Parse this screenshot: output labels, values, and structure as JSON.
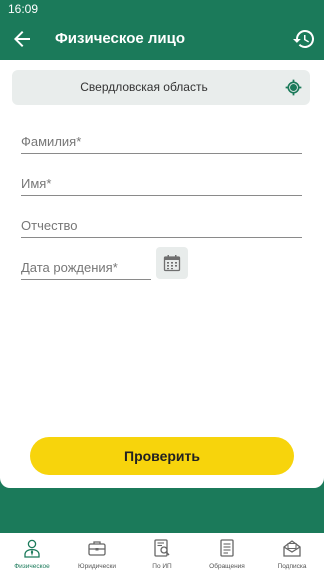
{
  "status_bar": {
    "time": "16:09"
  },
  "app_bar": {
    "title": "Физическое лицо",
    "back_icon": "arrow-back-icon",
    "history_icon": "history-icon"
  },
  "region": {
    "label": "Свердловская область",
    "locate_icon": "location-target-icon"
  },
  "form": {
    "last_name_placeholder": "Фамилия*",
    "first_name_placeholder": "Имя*",
    "patronymic_placeholder": "Отчество",
    "birth_date_placeholder": "Дата рождения*",
    "calendar_icon": "calendar-icon"
  },
  "actions": {
    "check_label": "Проверить"
  },
  "bottom_nav": {
    "items": [
      {
        "label": "Физическое",
        "icon": "person-icon",
        "active": true
      },
      {
        "label": "Юридически",
        "icon": "briefcase-icon",
        "active": false
      },
      {
        "label": "По ИП",
        "icon": "document-search-icon",
        "active": false
      },
      {
        "label": "Обращения",
        "icon": "document-icon",
        "active": false
      },
      {
        "label": "Подписка",
        "icon": "envelope-icon",
        "active": false
      }
    ]
  },
  "colors": {
    "primary": "#1b7a5a",
    "accent": "#f7d40c",
    "active_nav": "#1b7a5a"
  }
}
